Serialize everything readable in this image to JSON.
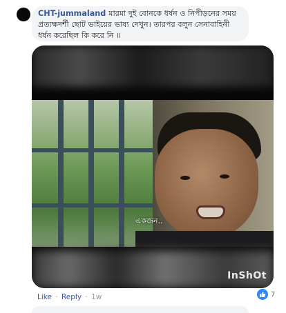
{
  "comment": {
    "author": "CHT-jummaland",
    "text": "মারমা দুই বোনকে ধর্ষন ও নিপীড়নের সময় প্রত্যক্ষদর্শী ছোট ভাইয়ের ভাষ্য দেখুন। তারপর বলুন সেনাবাহিনী ধর্ষন করেছিল কি করে নি ॥"
  },
  "video": {
    "subtitle": "একজন..",
    "watermark": "InShOt"
  },
  "actions": {
    "like": "Like",
    "reply": "Reply",
    "separator": "·",
    "time": "1w"
  },
  "reactions": {
    "icon": "like-icon",
    "count": "7",
    "color": "#2d88ff"
  },
  "colors": {
    "link": "#385898",
    "bubble": "#f2f3f5"
  }
}
